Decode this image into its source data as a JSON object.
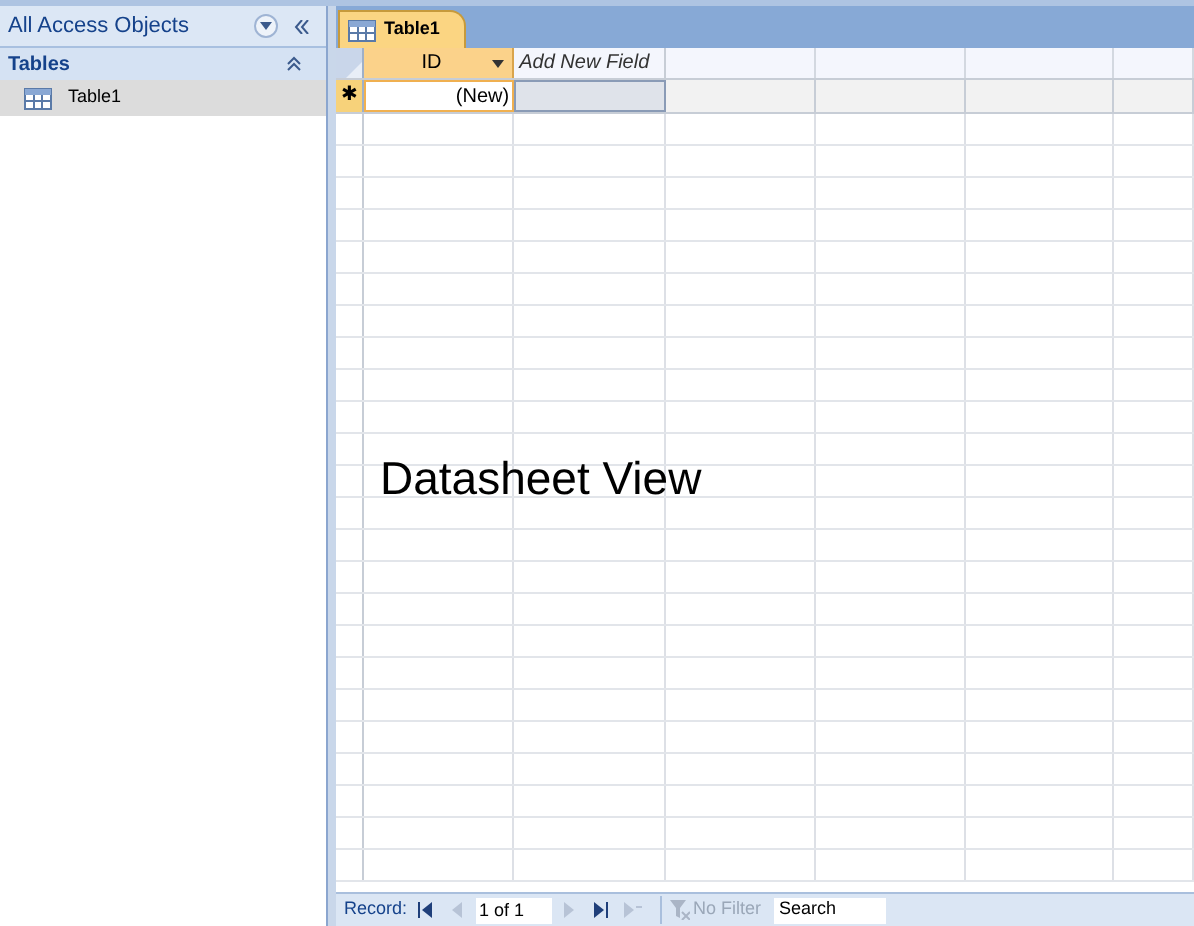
{
  "navigation_pane": {
    "title": "All Access Objects",
    "group": {
      "label": "Tables",
      "expanded": true
    },
    "items": [
      {
        "label": "Table1",
        "selected": true
      }
    ]
  },
  "document_tab": {
    "label": "Table1",
    "selected": true
  },
  "datasheet": {
    "columns": [
      {
        "label": "ID",
        "kind": "field"
      },
      {
        "label": "Add New Field",
        "kind": "add"
      }
    ],
    "new_row": {
      "marker": "✱",
      "id": "(New)"
    }
  },
  "overlay_caption": "Datasheet View",
  "record_bar": {
    "label": "Record:",
    "position": "1 of 1",
    "filter": "No Filter",
    "search": {
      "placeholder": "Search"
    }
  }
}
